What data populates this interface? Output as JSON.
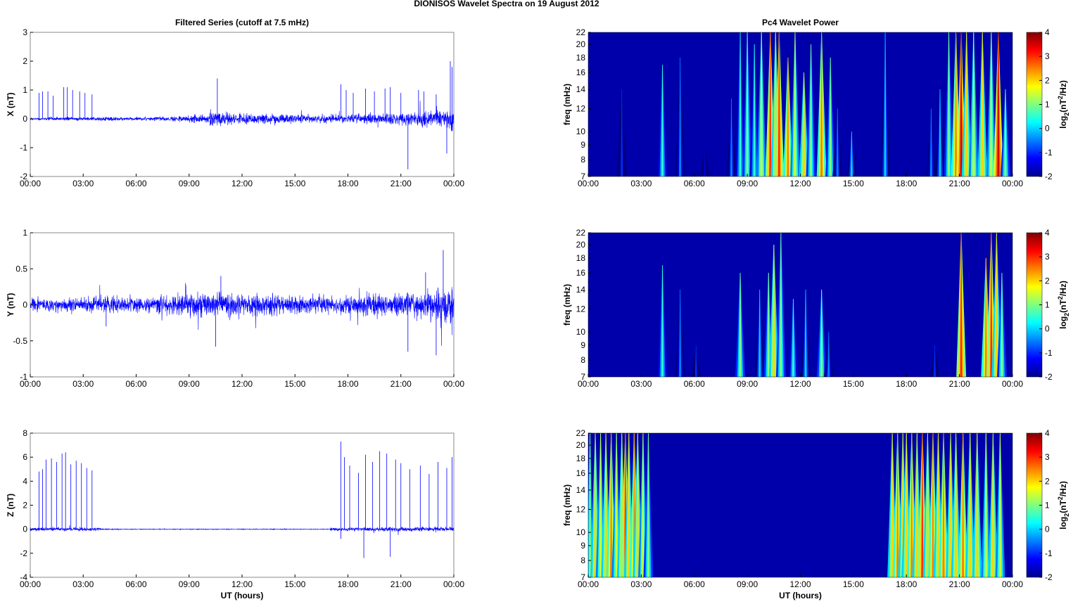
{
  "title": "DIONISOS Wavelet Spectra on 19 August    2012",
  "chart_data": [
    {
      "type": "line",
      "title": "Filtered Series (cutoff at 7.5 mHz)",
      "ylabel": "X (nT)",
      "xlabel": "",
      "ylim": [
        -2,
        3
      ],
      "yticks": [
        "-2",
        "-1",
        "0",
        "1",
        "2",
        "3"
      ],
      "xticks": [
        "00:00",
        "03:00",
        "06:00",
        "09:00",
        "12:00",
        "15:00",
        "18:00",
        "21:00",
        "00:00"
      ],
      "xlim_hours": [
        0,
        24
      ],
      "color": "#0000ff",
      "noise_amplitude_by_hour": [
        0.03,
        0.04,
        0.04,
        0.04,
        0.05,
        0.04,
        0.04,
        0.05,
        0.07,
        0.09,
        0.18,
        0.14,
        0.12,
        0.12,
        0.11,
        0.09,
        0.08,
        0.09,
        0.1,
        0.12,
        0.13,
        0.15,
        0.18,
        0.25
      ],
      "spikes": [
        [
          0.5,
          0.9
        ],
        [
          0.7,
          0.95
        ],
        [
          1.0,
          0.95
        ],
        [
          1.3,
          0.8
        ],
        [
          1.9,
          1.1
        ],
        [
          2.1,
          1.1
        ],
        [
          2.4,
          1.0
        ],
        [
          2.8,
          0.95
        ],
        [
          3.1,
          0.9
        ],
        [
          3.5,
          0.85
        ],
        [
          10.6,
          1.4
        ],
        [
          17.6,
          1.2
        ],
        [
          17.9,
          1.0
        ],
        [
          18.3,
          0.9
        ],
        [
          19.0,
          1.05
        ],
        [
          19.5,
          0.95
        ],
        [
          20.1,
          1.05
        ],
        [
          20.4,
          1.1
        ],
        [
          21.0,
          0.9
        ],
        [
          21.4,
          -1.75
        ],
        [
          22.0,
          1.0
        ],
        [
          22.3,
          0.95
        ],
        [
          23.0,
          0.85
        ],
        [
          23.6,
          -1.2
        ],
        [
          23.8,
          2.0
        ],
        [
          23.9,
          1.8
        ]
      ]
    },
    {
      "type": "line",
      "title": "",
      "ylabel": "Y (nT)",
      "xlabel": "",
      "ylim": [
        -1,
        1
      ],
      "yticks": [
        "-1",
        "-0.5",
        "0",
        "0.5",
        "1"
      ],
      "xticks": [
        "00:00",
        "03:00",
        "06:00",
        "09:00",
        "12:00",
        "15:00",
        "18:00",
        "21:00",
        "00:00"
      ],
      "xlim_hours": [
        0,
        24
      ],
      "color": "#0000ff",
      "noise_amplitude_by_hour": [
        0.06,
        0.06,
        0.07,
        0.07,
        0.08,
        0.07,
        0.07,
        0.08,
        0.09,
        0.11,
        0.12,
        0.11,
        0.1,
        0.1,
        0.09,
        0.08,
        0.08,
        0.09,
        0.09,
        0.1,
        0.1,
        0.12,
        0.13,
        0.17
      ],
      "spikes": [
        [
          4.3,
          -0.3
        ],
        [
          8.8,
          0.3
        ],
        [
          10.5,
          -0.58
        ],
        [
          10.8,
          0.4
        ],
        [
          21.4,
          -0.65
        ],
        [
          22.4,
          0.45
        ],
        [
          23.0,
          -0.7
        ],
        [
          23.4,
          0.76
        ]
      ]
    },
    {
      "type": "line",
      "title": "",
      "ylabel": "Z (nT)",
      "xlabel": "UT (hours)",
      "ylim": [
        -4,
        8
      ],
      "yticks": [
        "-4",
        "-2",
        "0",
        "2",
        "4",
        "6",
        "8"
      ],
      "xticks": [
        "00:00",
        "03:00",
        "06:00",
        "09:00",
        "12:00",
        "15:00",
        "18:00",
        "21:00",
        "00:00"
      ],
      "xlim_hours": [
        0,
        24
      ],
      "color": "#0000ff",
      "noise_amplitude_by_hour": [
        0.1,
        0.1,
        0.1,
        0.1,
        0.03,
        0.02,
        0.02,
        0.02,
        0.02,
        0.02,
        0.02,
        0.02,
        0.02,
        0.02,
        0.02,
        0.02,
        0.02,
        0.1,
        0.12,
        0.12,
        0.12,
        0.12,
        0.12,
        0.12
      ],
      "spikes": [
        [
          0.5,
          4.8
        ],
        [
          0.7,
          5.0
        ],
        [
          0.9,
          5.8
        ],
        [
          1.2,
          5.9
        ],
        [
          1.5,
          5.6
        ],
        [
          1.8,
          6.3
        ],
        [
          2.0,
          6.4
        ],
        [
          2.3,
          5.4
        ],
        [
          2.6,
          5.7
        ],
        [
          2.9,
          5.5
        ],
        [
          3.2,
          5.1
        ],
        [
          3.5,
          4.9
        ],
        [
          17.6,
          7.3
        ],
        [
          17.8,
          6.0
        ],
        [
          18.1,
          5.3
        ],
        [
          18.6,
          4.7
        ],
        [
          19.0,
          6.2
        ],
        [
          19.4,
          5.6
        ],
        [
          19.8,
          6.5
        ],
        [
          20.2,
          6.3
        ],
        [
          20.7,
          5.8
        ],
        [
          21.0,
          5.5
        ],
        [
          21.5,
          5.0
        ],
        [
          22.1,
          5.3
        ],
        [
          22.6,
          4.6
        ],
        [
          23.1,
          5.6
        ],
        [
          23.6,
          5.1
        ],
        [
          23.9,
          6.0
        ],
        [
          18.9,
          -2.4
        ],
        [
          20.4,
          -2.3
        ],
        [
          17.6,
          -0.8
        ]
      ]
    },
    {
      "type": "heatmap",
      "title": "Pc4 Wavelet Power",
      "ylabel": "freq (mHz)",
      "xlabel": "",
      "ylim": [
        7,
        22
      ],
      "yscale": "log",
      "yticks": [
        "7",
        "8",
        "9",
        "10",
        "12",
        "14",
        "16",
        "18",
        "20",
        "22"
      ],
      "xticks": [
        "00:00",
        "03:00",
        "06:00",
        "09:00",
        "12:00",
        "15:00",
        "18:00",
        "21:00",
        "00:00"
      ],
      "colorbar": {
        "label": "log2(nT^2/Hz)",
        "ticks": [
          "4",
          "3",
          "2",
          "1",
          "0",
          "-1",
          "-2"
        ],
        "range": [
          -2,
          4
        ]
      },
      "bursts_hours_power_topfreq": [
        [
          1.9,
          -1,
          14
        ],
        [
          4.2,
          0.5,
          17
        ],
        [
          5.2,
          -0.5,
          18
        ],
        [
          6.6,
          -1.5,
          9
        ],
        [
          8.1,
          -0.5,
          13
        ],
        [
          8.6,
          0.5,
          22
        ],
        [
          9.0,
          1,
          22
        ],
        [
          9.4,
          0.5,
          20
        ],
        [
          9.8,
          1.5,
          22
        ],
        [
          10.3,
          3,
          22
        ],
        [
          10.6,
          2,
          22
        ],
        [
          10.8,
          3,
          22
        ],
        [
          11.3,
          2.5,
          18
        ],
        [
          11.7,
          1.5,
          22
        ],
        [
          12.2,
          2,
          16
        ],
        [
          12.6,
          1,
          20
        ],
        [
          13.2,
          2.5,
          22
        ],
        [
          13.7,
          1,
          18
        ],
        [
          14.1,
          -0.5,
          12
        ],
        [
          14.9,
          0,
          10
        ],
        [
          16.8,
          0,
          22
        ],
        [
          19.4,
          -0.5,
          12
        ],
        [
          19.9,
          0,
          14
        ],
        [
          20.4,
          1,
          22
        ],
        [
          20.8,
          2.5,
          22
        ],
        [
          21.1,
          3.5,
          22
        ],
        [
          21.4,
          2,
          22
        ],
        [
          21.8,
          1.5,
          22
        ],
        [
          22.3,
          2,
          22
        ],
        [
          22.8,
          1.5,
          22
        ],
        [
          23.2,
          3.5,
          22
        ],
        [
          23.6,
          1,
          14
        ]
      ]
    },
    {
      "type": "heatmap",
      "title": "",
      "ylabel": "freq (mHz)",
      "xlabel": "",
      "ylim": [
        7,
        22
      ],
      "yscale": "log",
      "yticks": [
        "7",
        "8",
        "9",
        "10",
        "12",
        "14",
        "16",
        "18",
        "20",
        "22"
      ],
      "xticks": [
        "00:00",
        "03:00",
        "06:00",
        "09:00",
        "12:00",
        "15:00",
        "18:00",
        "21:00",
        "00:00"
      ],
      "colorbar": {
        "label": "log2(nT^2/Hz)",
        "ticks": [
          "4",
          "3",
          "2",
          "1",
          "0",
          "-1",
          "-2"
        ],
        "range": [
          -2,
          4
        ]
      },
      "bursts_hours_power_topfreq": [
        [
          4.2,
          0.5,
          17
        ],
        [
          5.2,
          -0.5,
          14
        ],
        [
          6.1,
          -1,
          9
        ],
        [
          8.6,
          1,
          16
        ],
        [
          9.7,
          0,
          14
        ],
        [
          10.2,
          1,
          16
        ],
        [
          10.5,
          2,
          20
        ],
        [
          10.9,
          1,
          22
        ],
        [
          11.6,
          0.5,
          13
        ],
        [
          12.3,
          0,
          14
        ],
        [
          13.2,
          1,
          14
        ],
        [
          13.6,
          -0.5,
          10
        ],
        [
          19.6,
          -1,
          9
        ],
        [
          21.1,
          3,
          22
        ],
        [
          22.5,
          2.5,
          18
        ],
        [
          22.8,
          3,
          22
        ],
        [
          23.1,
          2,
          22
        ],
        [
          23.4,
          1,
          16
        ]
      ]
    },
    {
      "type": "heatmap",
      "title": "",
      "ylabel": "freq (mHz)",
      "xlabel": "UT (hours)",
      "ylim": [
        7,
        22
      ],
      "yscale": "log",
      "yticks": [
        "7",
        "8",
        "9",
        "10",
        "12",
        "14",
        "16",
        "18",
        "20",
        "22"
      ],
      "xticks": [
        "00:00",
        "03:00",
        "06:00",
        "09:00",
        "12:00",
        "15:00",
        "18:00",
        "21:00",
        "00:00"
      ],
      "colorbar": {
        "label": "log2(nT^2/Hz)",
        "ticks": [
          "4",
          "3",
          "2",
          "1",
          "0",
          "-1",
          "-2"
        ],
        "range": [
          -2,
          4
        ]
      },
      "bursts_hours_power_topfreq": [
        [
          0.1,
          1,
          22
        ],
        [
          0.4,
          2,
          22
        ],
        [
          0.7,
          1.5,
          22
        ],
        [
          1.0,
          2,
          22
        ],
        [
          1.3,
          2.5,
          22
        ],
        [
          1.6,
          1.5,
          22
        ],
        [
          1.9,
          2,
          22
        ],
        [
          2.1,
          3,
          22
        ],
        [
          2.3,
          2,
          22
        ],
        [
          2.6,
          2.5,
          22
        ],
        [
          2.8,
          2,
          22
        ],
        [
          3.1,
          1.5,
          22
        ],
        [
          3.4,
          1,
          22
        ],
        [
          17.2,
          2,
          22
        ],
        [
          17.5,
          2.5,
          22
        ],
        [
          17.8,
          2,
          22
        ],
        [
          18.0,
          2,
          22
        ],
        [
          18.3,
          2.5,
          22
        ],
        [
          18.6,
          2,
          22
        ],
        [
          18.9,
          3,
          22
        ],
        [
          19.2,
          2,
          22
        ],
        [
          19.5,
          2.5,
          22
        ],
        [
          19.8,
          2,
          22
        ],
        [
          20.1,
          2.5,
          22
        ],
        [
          20.5,
          2,
          22
        ],
        [
          20.8,
          2,
          22
        ],
        [
          21.2,
          2.5,
          22
        ],
        [
          21.6,
          2,
          22
        ],
        [
          22.0,
          2,
          22
        ],
        [
          22.5,
          1.5,
          22
        ],
        [
          22.9,
          2,
          22
        ],
        [
          23.3,
          1.5,
          22
        ]
      ]
    }
  ]
}
